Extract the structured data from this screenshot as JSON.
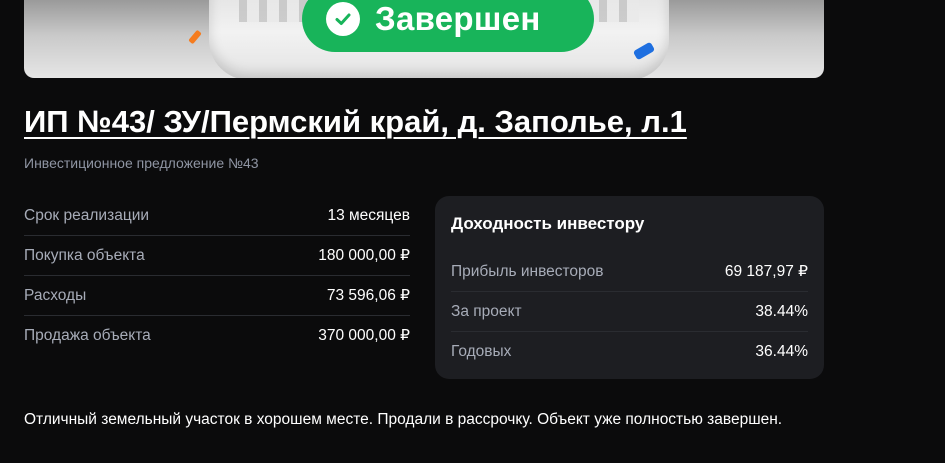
{
  "hero": {
    "status_label": "Завершен",
    "status_color": "#18b45a",
    "status_icon": "check-circle-icon"
  },
  "title": "ИП №43/ ЗУ/Пермский край, д. Заполье, л.1",
  "subtitle": "Инвестиционное предложение №43",
  "details": [
    {
      "label": "Срок реализации",
      "value": "13 месяцев"
    },
    {
      "label": "Покупка объекта",
      "value": "180 000,00 ₽"
    },
    {
      "label": "Расходы",
      "value": "73 596,06 ₽"
    },
    {
      "label": "Продажа объекта",
      "value": "370 000,00 ₽"
    }
  ],
  "returns": {
    "title": "Доходность инвестору",
    "items": [
      {
        "label": "Прибыль инвесторов",
        "value": "69 187,97 ₽"
      },
      {
        "label": "За проект",
        "value": "38.44%"
      },
      {
        "label": "Годовых",
        "value": "36.44%"
      }
    ]
  },
  "description": "Отличный земельный участок в хорошем месте. Продали в рассрочку. Объект уже полностью завершен."
}
